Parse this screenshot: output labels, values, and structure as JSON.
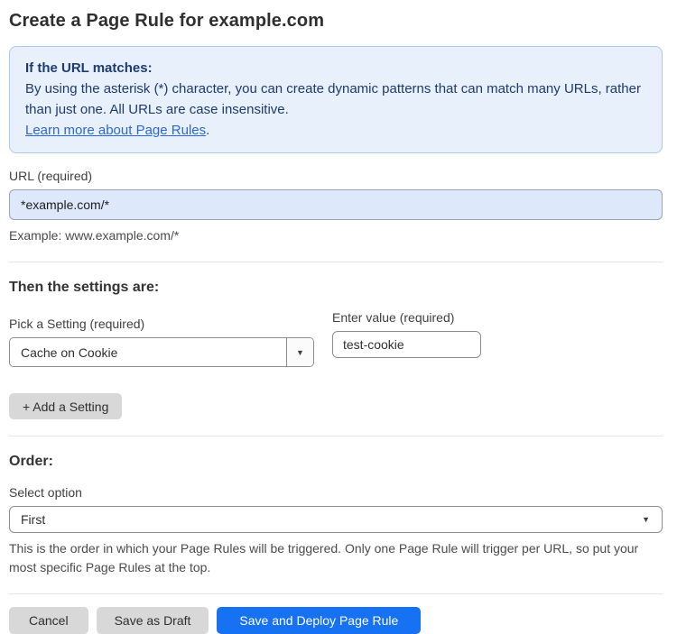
{
  "page": {
    "title": "Create a Page Rule for example.com"
  },
  "info_box": {
    "heading": "If the URL matches:",
    "body": "By using the asterisk (*) character, you can create dynamic patterns that can match many URLs, rather than just one. All URLs are case insensitive.",
    "link_label": "Learn more about Page Rules",
    "link_suffix": "."
  },
  "url_field": {
    "label": "URL (required)",
    "value": "*example.com/*",
    "example": "Example: www.example.com/*"
  },
  "settings": {
    "heading": "Then the settings are:",
    "setting_label": "Pick a Setting (required)",
    "setting_selected": "Cache on Cookie",
    "value_label": "Enter value (required)",
    "value_current": "test-cookie",
    "add_button_label": "+ Add a Setting",
    "dropdown_arrow": "▼"
  },
  "order": {
    "heading": "Order:",
    "select_label": "Select option",
    "selected_option": "First",
    "select_arrow": "▼",
    "helper": "This is the order in which your Page Rules will be triggered. Only one Page Rule will trigger per URL, so put your most specific Page Rules at the top."
  },
  "actions": {
    "cancel_label": "Cancel",
    "save_draft_label": "Save as Draft",
    "save_deploy_label": "Save and Deploy Page Rule"
  },
  "colors": {
    "accent_blue": "#1671f3",
    "info_bg": "#e8f1fb",
    "info_border": "#abc9ec",
    "info_text": "#1e3a6e",
    "link_blue": "#2c68d3",
    "url_input_bg": "#dde9fb"
  }
}
